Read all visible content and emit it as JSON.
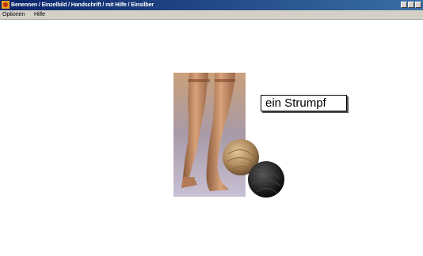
{
  "window": {
    "title": "Benennen / Einzelbild / Handschrift / mit Hilfe / Einsilber",
    "app_icon": "app-icon"
  },
  "menu": {
    "items": [
      {
        "label": "Optionen"
      },
      {
        "label": "Hilfe"
      }
    ]
  },
  "content": {
    "image": "stockings-photo",
    "word_label": "ein Strumpf"
  },
  "colors": {
    "titlebar": "#0a246a",
    "background": "#ffffff"
  }
}
